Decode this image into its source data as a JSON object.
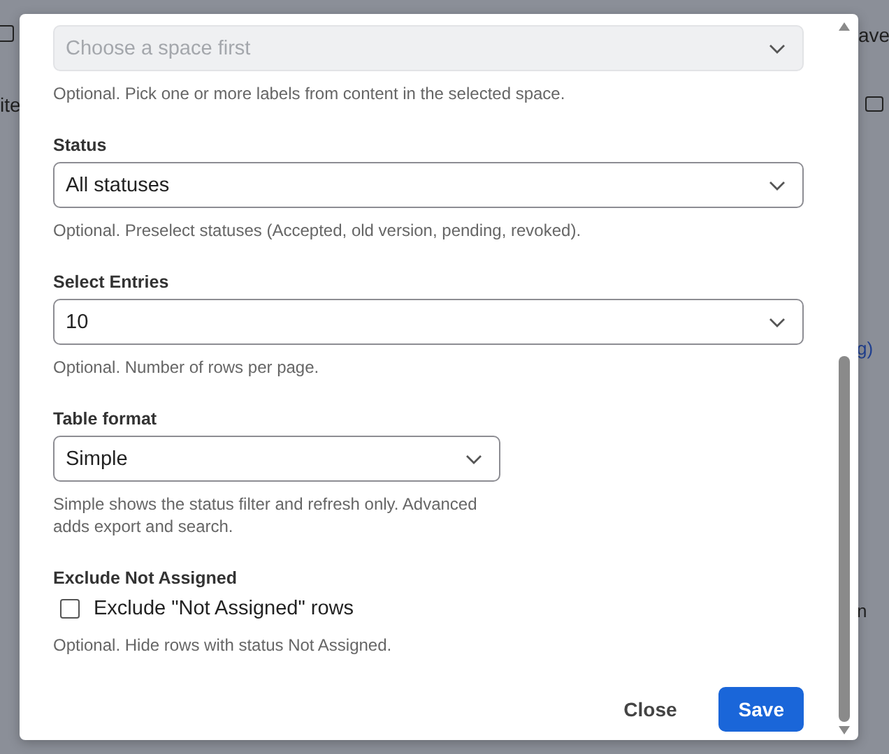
{
  "backdrop": {
    "fragments": [
      "ave",
      "ite",
      "g)",
      "n"
    ]
  },
  "dialog": {
    "fields": [
      {
        "kind": "select",
        "placeholder": "Choose a space first",
        "disabled": true,
        "hint": "Optional. Pick one or more labels from content in the selected space."
      },
      {
        "kind": "select",
        "label": "Status",
        "value": "All statuses",
        "disabled": false,
        "hint": "Optional. Preselect statuses (Accepted, old version, pending, revoked)."
      },
      {
        "kind": "select",
        "label": "Select Entries",
        "value": "10",
        "disabled": false,
        "hint": "Optional. Number of rows per page."
      },
      {
        "kind": "select",
        "label": "Table format",
        "value": "Simple",
        "disabled": false,
        "hint": "Simple shows the status filter and refresh only. Advanced adds export and search."
      },
      {
        "kind": "checkbox",
        "label": "Exclude Not Assigned",
        "option": "Exclude \"Not Assigned\" rows",
        "checked": false,
        "hint": "Optional. Hide rows with status Not Assigned."
      }
    ],
    "buttons": [
      {
        "label": "Close",
        "primary": false
      },
      {
        "label": "Save",
        "primary": true
      }
    ]
  }
}
